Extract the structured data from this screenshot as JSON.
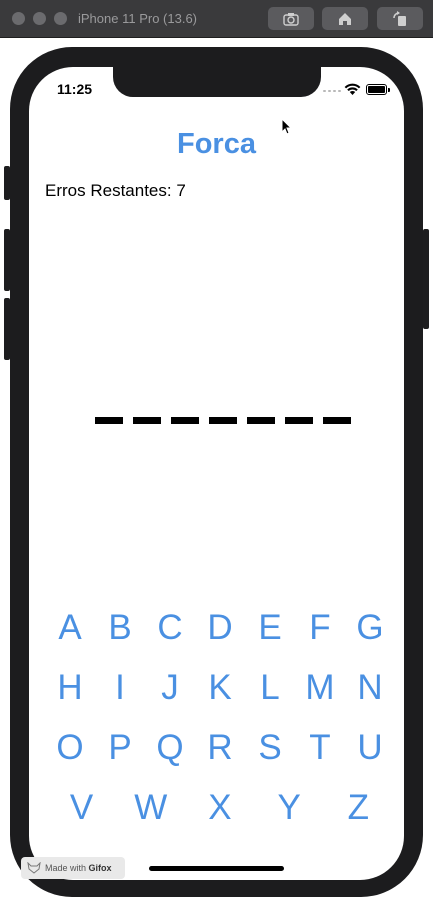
{
  "window": {
    "title": "iPhone 11 Pro (13.6)",
    "buttons": [
      {
        "name": "screenshot",
        "icon": "camera-icon"
      },
      {
        "name": "home",
        "icon": "home-icon"
      },
      {
        "name": "rotate",
        "icon": "rotate-icon"
      }
    ]
  },
  "status_bar": {
    "time": "11:25",
    "icons": [
      "signal-icon",
      "wifi-icon",
      "battery-icon"
    ]
  },
  "app": {
    "title": "Forca",
    "errors_label": "Erros Restantes: 7",
    "word_slots": 7,
    "accent_color": "#4a90e2"
  },
  "keyboard": {
    "rows": [
      [
        "A",
        "B",
        "C",
        "D",
        "E",
        "F",
        "G"
      ],
      [
        "H",
        "I",
        "J",
        "K",
        "L",
        "M",
        "N"
      ],
      [
        "O",
        "P",
        "Q",
        "R",
        "S",
        "T",
        "U"
      ],
      [
        "V",
        "W",
        "X",
        "Y",
        "Z"
      ]
    ]
  },
  "watermark": {
    "prefix": "Made with",
    "brand": "Gifox"
  }
}
